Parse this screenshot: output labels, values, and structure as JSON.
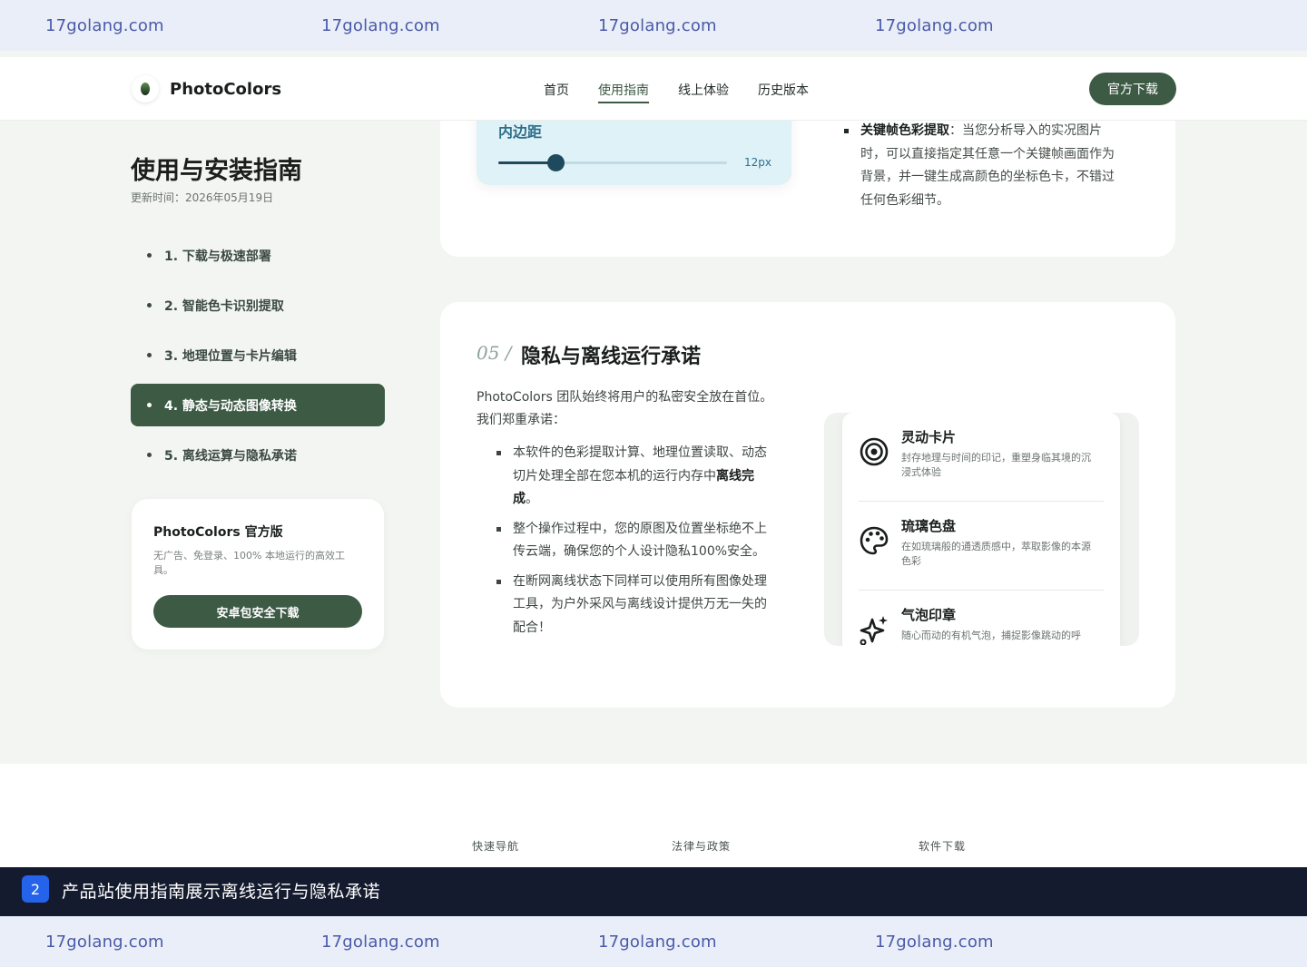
{
  "watermark": {
    "text": [
      "17golang.com",
      "17golang.com",
      "17golang.com",
      "17golang.com"
    ]
  },
  "header": {
    "brand": "PhotoColors",
    "nav": [
      {
        "label": "首页",
        "active": false
      },
      {
        "label": "使用指南",
        "active": true
      },
      {
        "label": "线上体验",
        "active": false
      },
      {
        "label": "历史版本",
        "active": false
      }
    ],
    "download_label": "官方下载"
  },
  "sidebar": {
    "title": "使用与安装指南",
    "updated": "更新时间：2026年05月19日",
    "toc": [
      {
        "label": "1. 下载与极速部署",
        "active": false
      },
      {
        "label": "2. 智能色卡识别提取",
        "active": false
      },
      {
        "label": "3. 地理位置与卡片编辑",
        "active": false
      },
      {
        "label": "4. 静态与动态图像转换",
        "active": true
      },
      {
        "label": "5. 离线运算与隐私承诺",
        "active": false
      }
    ],
    "card": {
      "title": "PhotoColors 官方版",
      "desc": "无广告、免登录、100% 本地运行的高效工具。",
      "button": "安卓包安全下载"
    }
  },
  "top_card": {
    "padding_label": "内边距",
    "padding_value": "12px",
    "padding_slider_fraction": 0.25,
    "bullet_bold": "关键帧色彩提取",
    "bullet_text": "：当您分析导入的实况图片时，可以直接指定其任意一个关键帧画面作为背景，并一键生成高颜色的坐标色卡，不错过任何色彩细节。"
  },
  "section": {
    "number": "05 /",
    "title": "隐私与离线运行承诺",
    "intro": "PhotoColors 团队始终将用户的私密安全放在首位。我们郑重承诺：",
    "bullets": [
      {
        "text": "本软件的色彩提取计算、地理位置读取、动态切片处理全部在您本机的运行内存中",
        "bold": "离线完成",
        "tail": "。"
      },
      {
        "text": "整个操作过程中，您的原图及位置坐标绝不上传云端，确保您的个人设计隐私100%安全。",
        "bold": "",
        "tail": ""
      },
      {
        "text": "在断网离线状态下同样可以使用所有图像处理工具，为户外采风与离线设计提供万无一失的配合！",
        "bold": "",
        "tail": ""
      }
    ],
    "features": [
      {
        "icon": "target-icon",
        "title": "灵动卡片",
        "desc": "封存地理与时间的印记，重塑身临其境的沉浸式体验"
      },
      {
        "icon": "palette-icon",
        "title": "琉璃色盘",
        "desc": "在如琉璃般的通透质感中，萃取影像的本源色彩"
      },
      {
        "icon": "sparkle-icon",
        "title": "气泡印章",
        "desc": "随心而动的有机气泡，捕捉影像跳动的呼"
      }
    ]
  },
  "footer": {
    "columns": [
      "快速导航",
      "法律与政策",
      "软件下载"
    ]
  },
  "caption": {
    "badge": "2",
    "text": "产品站使用指南展示离线运行与隐私承诺"
  }
}
